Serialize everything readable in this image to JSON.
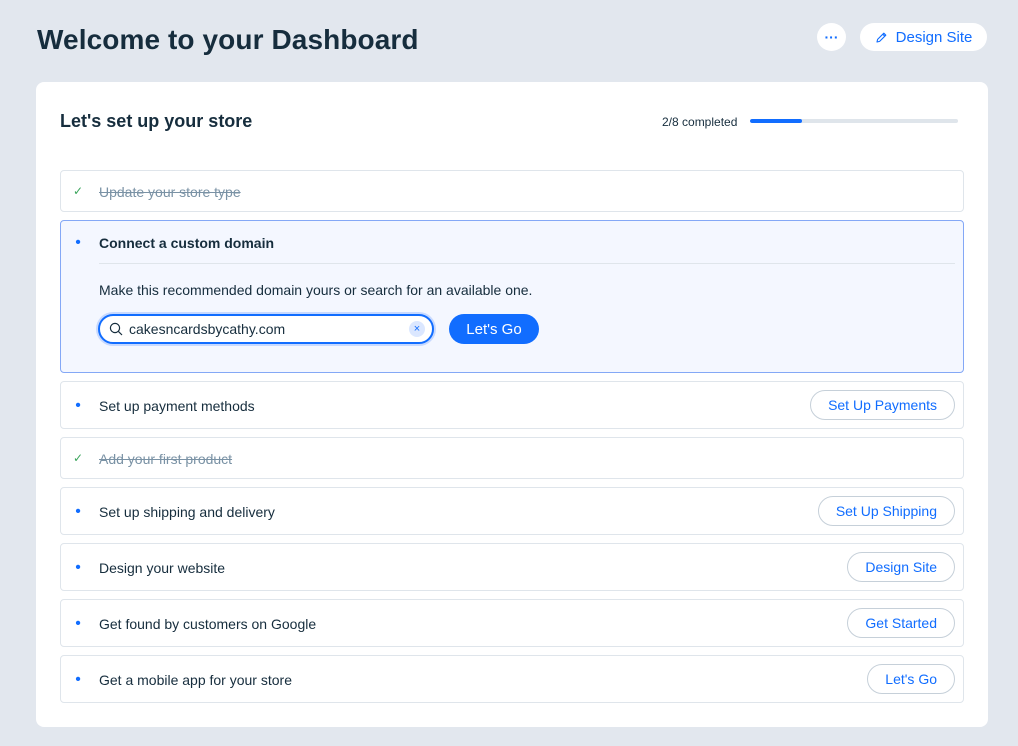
{
  "header": {
    "title": "Welcome to your Dashboard",
    "more_label": "···",
    "design_site_label": "Design Site",
    "more_icon": "more-icon",
    "design_icon": "pencil-icon"
  },
  "setup": {
    "title": "Let's set up your store",
    "progress_text": "2/8 completed",
    "progress_fraction": 0.25
  },
  "tasks": [
    {
      "label": "Update your store type",
      "done": true
    },
    {
      "label": "Connect a custom domain",
      "done": false,
      "expanded": true,
      "description": "Make this recommended domain yours or search for an available one.",
      "search_value": "cakesncardsbycathy.com",
      "clear_label": "×",
      "go_label": "Let's Go"
    },
    {
      "label": "Set up payment methods",
      "done": false,
      "action": "Set Up Payments"
    },
    {
      "label": "Add your first product",
      "done": true
    },
    {
      "label": "Set up shipping and delivery",
      "done": false,
      "action": "Set Up Shipping"
    },
    {
      "label": "Design your website",
      "done": false,
      "action": "Design Site"
    },
    {
      "label": "Get found by customers on Google",
      "done": false,
      "action": "Get Started"
    },
    {
      "label": "Get a mobile app for your store",
      "done": false,
      "action": "Let's Go"
    }
  ],
  "markers": {
    "done": "✓",
    "todo": "•"
  },
  "colors": {
    "accent": "#116dff",
    "background": "#e2e7ee",
    "check": "#3ba55c",
    "expanded_bg": "#f4f7ff"
  }
}
